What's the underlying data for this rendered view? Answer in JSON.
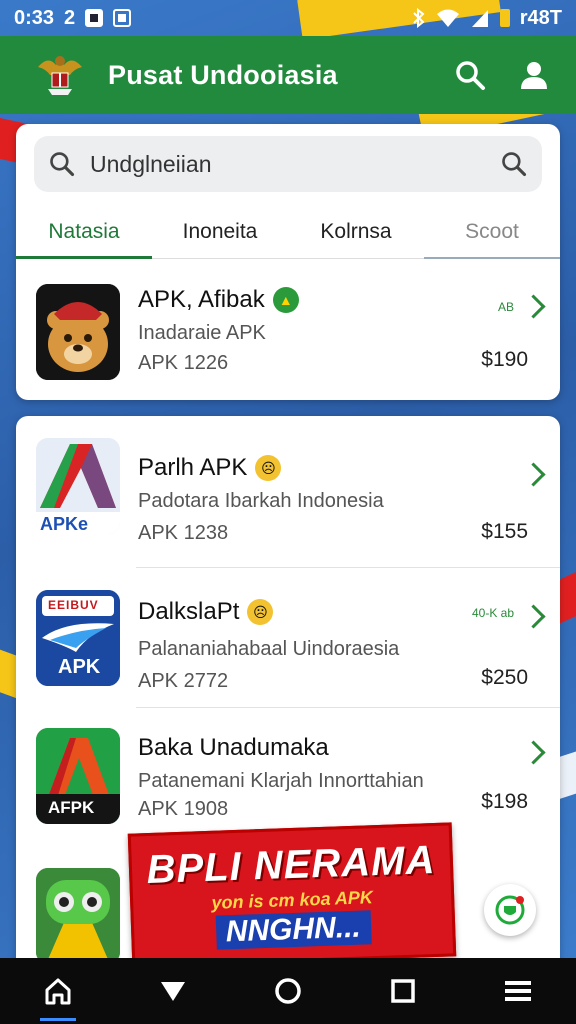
{
  "status_bar": {
    "time": "0:33",
    "indicator": "2",
    "carrier": "r48T"
  },
  "app_bar": {
    "title": "Pusat Undooiasia"
  },
  "search": {
    "value": "Undglneiian"
  },
  "tabs": [
    {
      "label": "Natasia",
      "active": true
    },
    {
      "label": "Inoneita",
      "active": false
    },
    {
      "label": "Kolrnsa",
      "active": false
    },
    {
      "label": "Scoot",
      "active": false
    }
  ],
  "featured_app": {
    "name": "APK, Afibak",
    "subtitle": "Inadaraie APK",
    "size": "APK 1226",
    "price": "$190",
    "tag": "AB"
  },
  "apps": [
    {
      "name": "Parlh APK",
      "subtitle": "Padotara Ibarkah Indonesia",
      "size": "APK 1238",
      "price": "$155",
      "tag": ""
    },
    {
      "name": "DalkslaPt",
      "subtitle": "Palananiahabaal Uindoraesia",
      "size": "APK 2772",
      "price": "$250",
      "tag": "40-K ab"
    },
    {
      "name": "Baka Unadumaka",
      "subtitle": "Patanemani Klarjah Innorttahian",
      "size": "APK 1908",
      "price": "$198",
      "tag": ""
    }
  ],
  "app_icon_labels": {
    "icon2": "APKe",
    "icon3_top": "EEIBUV",
    "icon3": "APK",
    "icon4": "AFPK"
  },
  "promo": {
    "line1": "BPLI NERAMA",
    "line2": "yon is cm koa APK",
    "line3": "NNGHN..."
  },
  "colors": {
    "primary_green": "#218a3c",
    "accent_red": "#d8141c",
    "accent_yellow": "#f5c518"
  },
  "nav": [
    "home-icon",
    "back-triangle-icon",
    "circle-icon",
    "square-icon",
    "menu-icon"
  ]
}
